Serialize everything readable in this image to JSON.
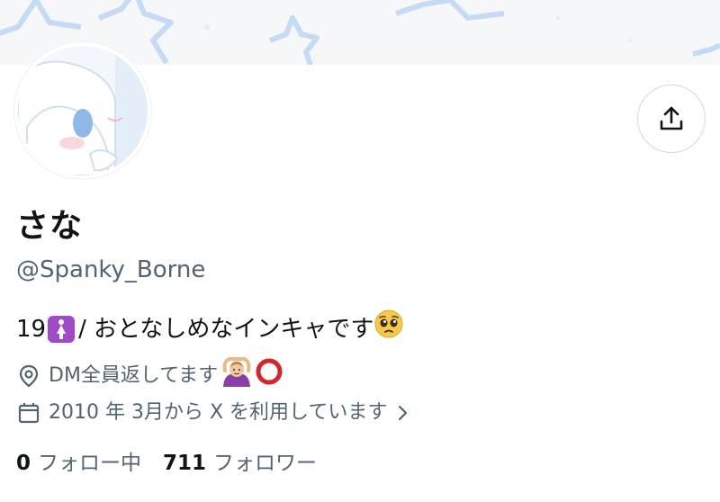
{
  "profile": {
    "display_name": "さな",
    "handle": "@Spanky_Borne",
    "bio": {
      "prefix": "19",
      "prefix_emoji": "woman-symbol-emoji",
      "text": " / おとなしめなインキャです",
      "suffix_emoji": "pleading-face-emoji"
    },
    "location": {
      "icon": "location-pin-icon",
      "text": "DM全員返してます",
      "emojis": [
        "woman-gesturing-ok-emoji",
        "red-circle-emoji"
      ]
    },
    "joined": {
      "icon": "calendar-icon",
      "text": "2010 年 3月から X を利用しています",
      "chevron": "chevron-right-icon"
    },
    "stats": {
      "following_count": "0",
      "following_label": "フォロー中",
      "followers_count": "711",
      "followers_label": "フォロワー"
    }
  },
  "actions": {
    "share_icon": "share-icon"
  },
  "colors": {
    "text_primary": "#0f1419",
    "text_secondary": "#536471",
    "border": "#cfd9de",
    "banner_star": "#bcd6f5",
    "avatar_accent": "#8fb8e8"
  }
}
